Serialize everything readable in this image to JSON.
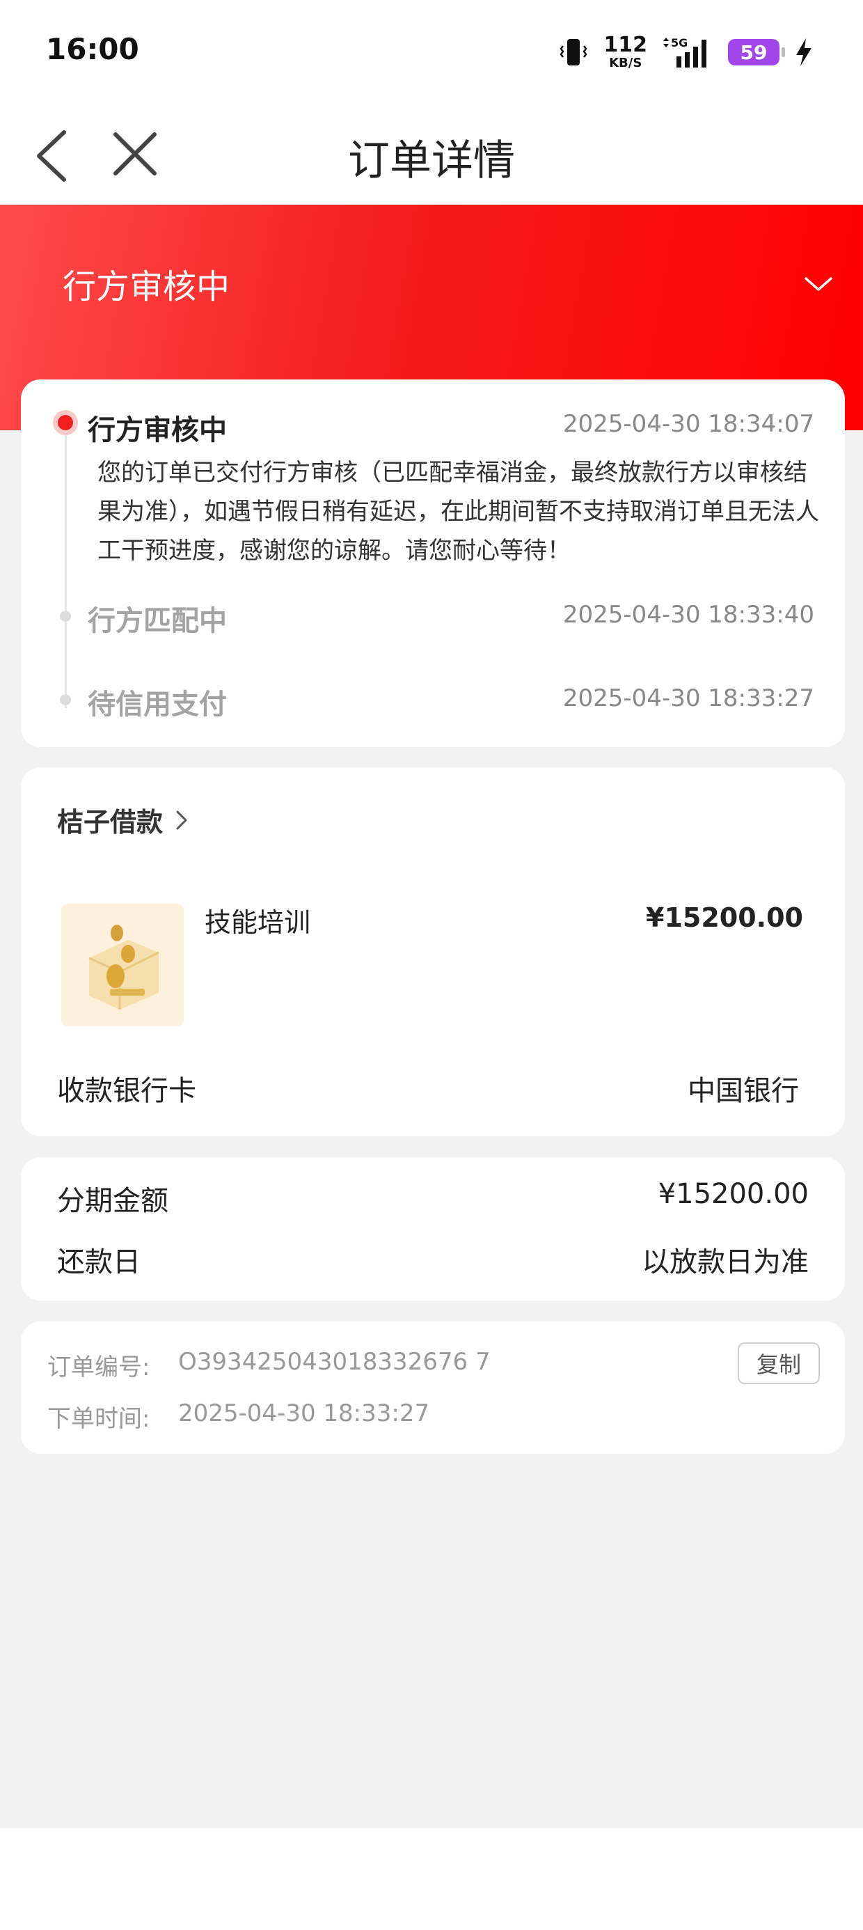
{
  "status_bar": {
    "time": "16:00",
    "net_speed": "112",
    "net_unit": "KB/S",
    "network": "5G",
    "battery": "59"
  },
  "nav": {
    "title": "订单详情"
  },
  "banner": {
    "status": "行方审核中"
  },
  "timeline": [
    {
      "title": "行方审核中",
      "time": "2025-04-30 18:34:07",
      "desc": "您的订单已交付行方审核（已匹配幸福消金，最终放款行方以审核结果为准），如遇节假日稍有延迟，在此期间暂不支持取消订单且无法人工干预进度，感谢您的谅解。请您耐心等待！"
    },
    {
      "title": "行方匹配中",
      "time": "2025-04-30 18:33:40"
    },
    {
      "title": "待信用支付",
      "time": "2025-04-30 18:33:27"
    }
  ],
  "product": {
    "shop": "桔子借款",
    "item_name": "技能培训",
    "item_price": "¥15200.00",
    "bank_label": "收款银行卡",
    "bank_value": "中国银行"
  },
  "installment": {
    "amount_label": "分期金额",
    "amount_value": "¥15200.00",
    "due_label": "还款日",
    "due_value": "以放款日为准"
  },
  "order": {
    "number_label": "订单编号:",
    "number_value": "O393425043018332676 7",
    "time_label": "下单时间:",
    "time_value": "2025-04-30 18:33:27",
    "copy_label": "复制"
  },
  "colors": {
    "accent_red": "#f01e1e",
    "battery": "#a046e8"
  }
}
